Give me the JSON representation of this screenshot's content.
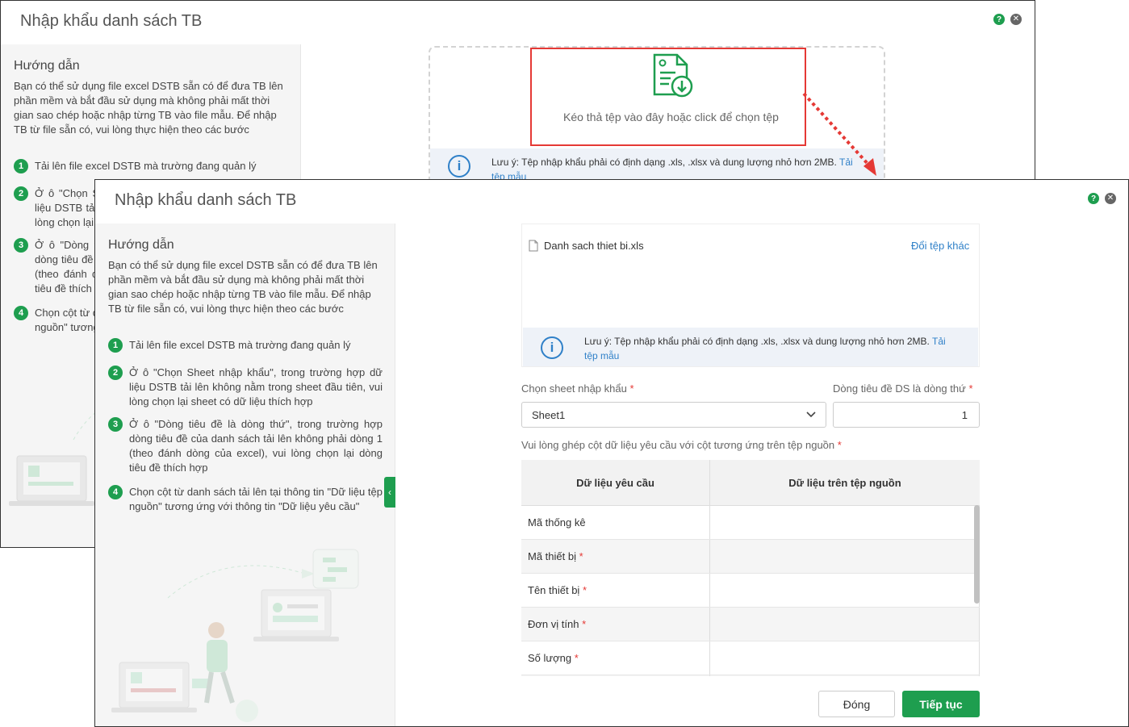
{
  "dialog_title": "Nhập khẩu danh sách TB",
  "guide": {
    "title": "Hướng dẫn",
    "intro": "Bạn có thể sử dụng file excel DSTB sẵn có để đưa TB lên phần mềm và bắt đầu sử dụng mà không phải mất thời gian sao chép hoặc nhập từng TB vào file mẫu. Để nhập TB từ file sẵn có, vui lòng thực hiện theo các bước",
    "steps": [
      {
        "num": "1",
        "text": "Tải lên file excel DSTB mà trường đang quản lý"
      },
      {
        "num": "2",
        "text": "Ở ô \"Chọn Sheet nhập khẩu\", trong trường hợp dữ liệu DSTB tải lên không nằm trong sheet đầu tiên, vui lòng chọn lại sheet có dữ liệu thích hợp"
      },
      {
        "num": "3",
        "text": "Ở ô \"Dòng tiêu đề là dòng thứ\", trong trường hợp dòng tiêu đề của danh sách tải lên không phải dòng 1 (theo đánh dòng của excel), vui lòng chọn lại dòng tiêu đề thích hợp"
      },
      {
        "num": "4",
        "text": "Chọn cột từ danh sách tải lên tại thông tin \"Dữ liệu tệp nguồn\" tương ứng với thông tin \"Dữ liệu yêu cầu\""
      }
    ]
  },
  "upload": {
    "drop_text": "Kéo thả tệp vào đây hoặc click để chọn tệp",
    "note_text": "Lưu ý: Tệp nhập khẩu phải có định dạng .xls, .xlsx và dung lượng nhỏ hơn 2MB.",
    "note_link": "Tải tệp mẫu",
    "note_link_partial": "Tải",
    "note_link_partial_2": "tệp mẫu"
  },
  "file": {
    "name": "Danh sach thiet bi.xls",
    "change_link": "Đổi tệp khác"
  },
  "form": {
    "sheet_label": "Chọn sheet nhập khẩu",
    "sheet_value": "Sheet1",
    "header_row_label": "Dòng tiêu đề DS là dòng thứ",
    "header_row_value": "1",
    "mapping_hint": "Vui lòng ghép cột dữ liệu yêu cầu với cột tương ứng trên tệp nguồn",
    "required_mark": "*"
  },
  "table": {
    "headers": [
      "Dữ liệu yêu cầu",
      "Dữ liệu trên tệp nguồn"
    ],
    "rows": [
      {
        "label": "Mã thống kê",
        "required": ""
      },
      {
        "label": "Mã thiết bị",
        "required": "*"
      },
      {
        "label": "Tên thiết bị",
        "required": "*"
      },
      {
        "label": "Đơn vị tính",
        "required": "*"
      },
      {
        "label": "Số lượng",
        "required": "*"
      }
    ]
  },
  "buttons": {
    "close": "Đóng",
    "next": "Tiếp tục"
  },
  "colors": {
    "brand_green": "#1e9e4f",
    "link_blue": "#2f80c8",
    "required_red": "#e53935"
  }
}
